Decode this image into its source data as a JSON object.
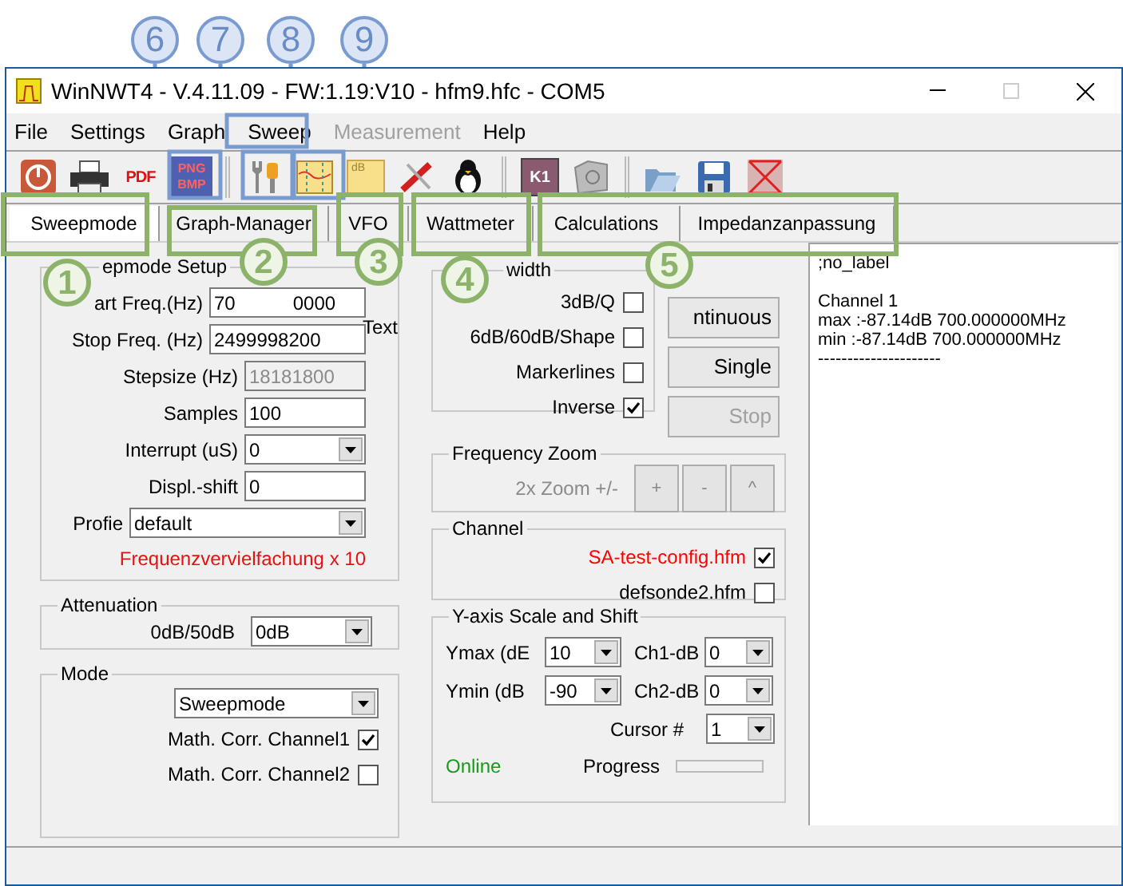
{
  "window": {
    "title": "WinNWT4 - V.4.11.09 - FW:1.19:V10 - hfm9.hfc - COM5"
  },
  "menu": [
    {
      "label": "File",
      "disabled": false
    },
    {
      "label": "Settings",
      "disabled": false
    },
    {
      "label": "Graph",
      "disabled": false
    },
    {
      "label": "Sweep",
      "disabled": false
    },
    {
      "label": "Measurement",
      "disabled": true
    },
    {
      "label": "Help",
      "disabled": false
    }
  ],
  "toolbar": [
    {
      "kind": "power"
    },
    {
      "kind": "printer"
    },
    {
      "kind": "pdf",
      "label": "PDF"
    },
    {
      "kind": "image",
      "label": "PNG",
      "label2": "BMP"
    },
    {
      "kind": "separator"
    },
    {
      "kind": "tools"
    },
    {
      "kind": "graph"
    },
    {
      "kind": "db",
      "label": "dB"
    },
    {
      "kind": "redtools"
    },
    {
      "kind": "penguin"
    },
    {
      "kind": "separator"
    },
    {
      "kind": "k1",
      "label": "K1"
    },
    {
      "kind": "k2"
    },
    {
      "kind": "separator"
    },
    {
      "kind": "open"
    },
    {
      "kind": "save"
    },
    {
      "kind": "hourglass"
    }
  ],
  "tabs": [
    {
      "label": "Sweepmode",
      "selected": true
    },
    {
      "label": "Graph-Manager",
      "selected": false
    },
    {
      "label": "VFO",
      "selected": false
    },
    {
      "label": "Wattmeter",
      "selected": false
    },
    {
      "label": "Calculations",
      "selected": false
    },
    {
      "label": "Impedanzanpassung",
      "selected": false
    }
  ],
  "sweep_setup": {
    "title": "epmode Setup",
    "side_note": "Text",
    "fields": [
      {
        "kind": "input",
        "label": "art Freq.(Hz)",
        "value": "70",
        "value_tail": "0000",
        "disabled": false
      },
      {
        "kind": "input",
        "label": "Stop Freq. (Hz)",
        "value": "2499998200",
        "disabled": false
      },
      {
        "kind": "input",
        "label": "Stepsize (Hz)",
        "value": "18181800",
        "disabled": true
      },
      {
        "kind": "input",
        "label": "Samples",
        "value": "100",
        "disabled": false
      },
      {
        "kind": "dropdown",
        "label": "Interrupt (uS)",
        "value": "0"
      },
      {
        "kind": "input",
        "label": "Displ.-shift",
        "value": "0",
        "disabled": false
      },
      {
        "kind": "dropdown",
        "label": "Profie",
        "value": "default"
      }
    ],
    "warning": "Frequenzvervielfachung x 10"
  },
  "attenuation": {
    "title": "Attenuation",
    "label": "0dB/50dB",
    "value": "0dB"
  },
  "mode": {
    "title": "Mode",
    "value": "Sweepmode",
    "checks": [
      {
        "label": "Math. Corr. Channel1",
        "checked": true
      },
      {
        "label": "Math. Corr. Channel2",
        "checked": false
      }
    ]
  },
  "bandwidth": {
    "title": "width",
    "checks": [
      {
        "label": "3dB/Q",
        "checked": false
      },
      {
        "label": "6dB/60dB/Shape",
        "checked": false
      },
      {
        "label": "Markerlines",
        "checked": false
      },
      {
        "label": "Inverse",
        "checked": true
      }
    ]
  },
  "sweep_buttons": [
    {
      "label": "ntinuous",
      "disabled": false
    },
    {
      "label": "Single",
      "disabled": false
    },
    {
      "label": "Stop",
      "disabled": true
    }
  ],
  "frequency_zoom": {
    "title": "Frequency Zoom",
    "label": "2x Zoom +/-",
    "buttons": [
      "+",
      "-",
      "^"
    ]
  },
  "channel": {
    "title": "Channel",
    "files": [
      {
        "label": "SA-test-config.hfm",
        "checked": true,
        "color": "#ff0000"
      },
      {
        "label": "defsonde2.hfm",
        "checked": false,
        "color": "#000000"
      }
    ]
  },
  "y_axis": {
    "title": "Y-axis Scale and Shift",
    "rows": [
      {
        "label": "Ymax (dE",
        "value": "10",
        "label2": "Ch1-dB",
        "value2": "0"
      },
      {
        "label": "Ymin (dB",
        "value": "-90",
        "label2": "Ch2-dB",
        "value2": "0"
      }
    ],
    "cursor": {
      "label": "Cursor #",
      "value": "1"
    },
    "status": "Online",
    "progress": {
      "label": "Progress",
      "level": 0
    }
  },
  "output": {
    "lines": [
      ";no_label",
      "Channel 1",
      "max :-87.14dB 700.000000MHz",
      "min :-87.14dB 700.000000MHz",
      "---------------------"
    ]
  },
  "annotations": {
    "toolbar_markers": [
      "6",
      "7",
      "8",
      "9"
    ],
    "tab_markers": [
      "1",
      "2",
      "3",
      "4",
      "5"
    ]
  }
}
